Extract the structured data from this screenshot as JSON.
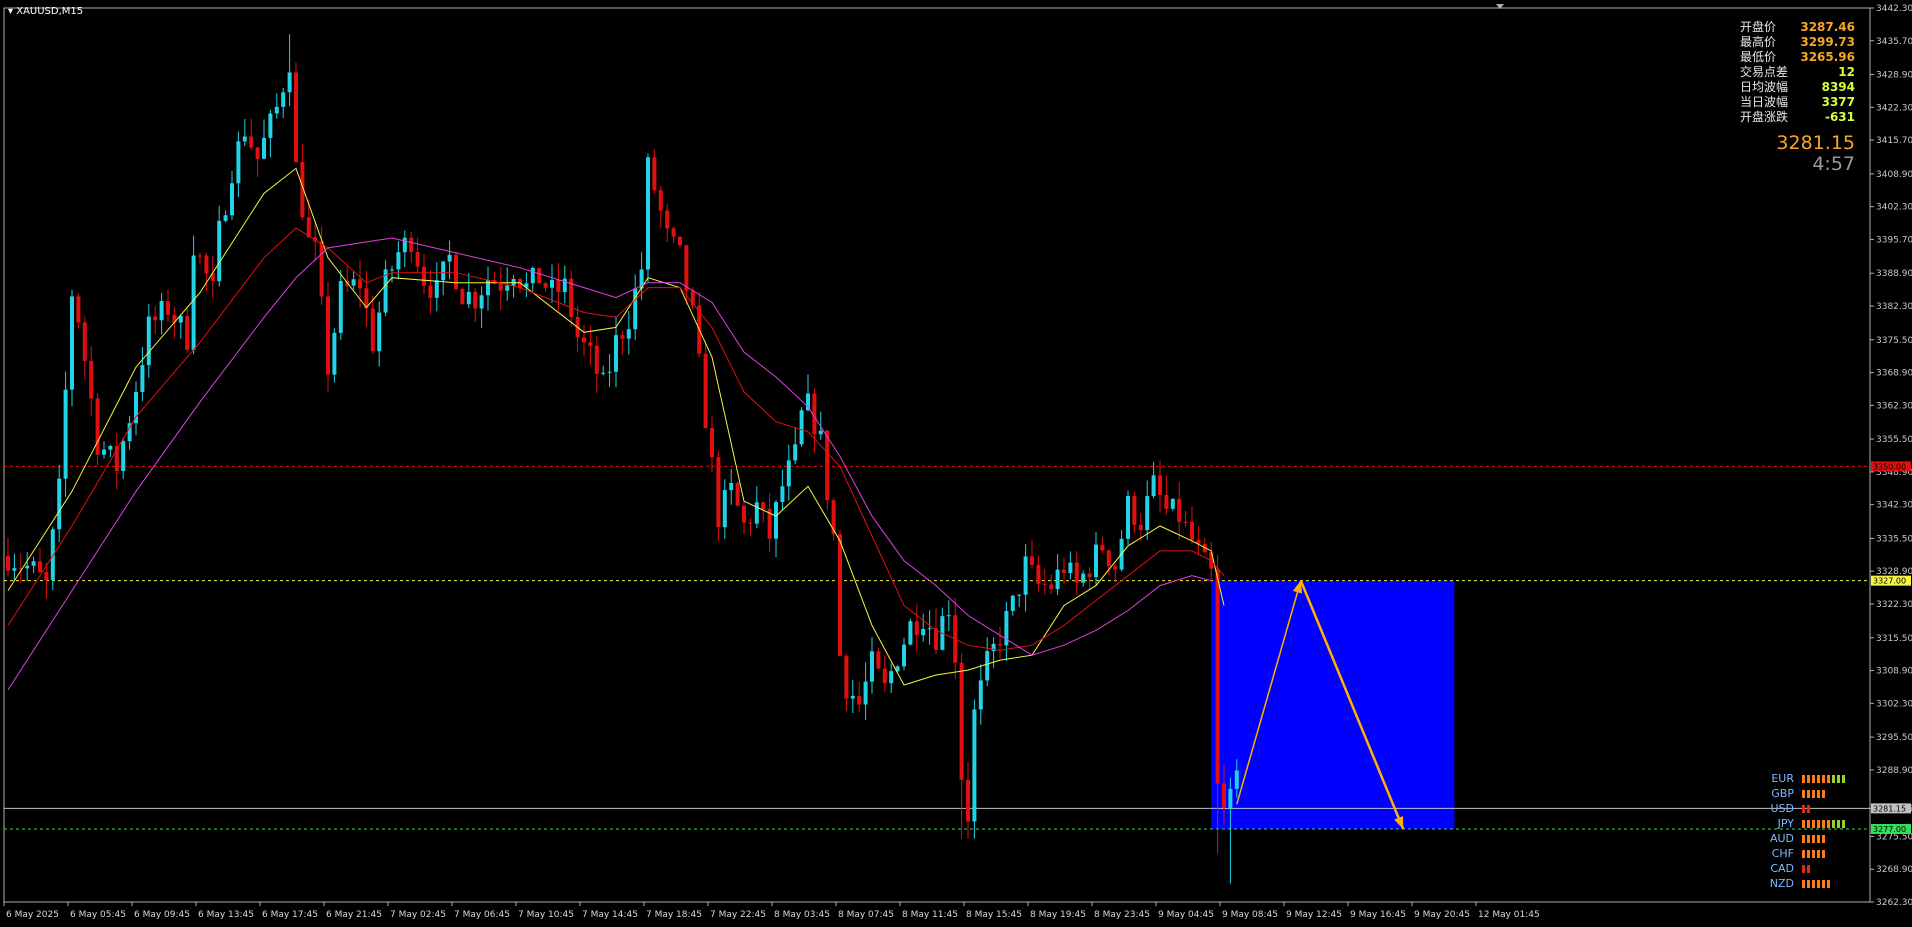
{
  "symbol": "XAUUSD,M15",
  "stats": [
    {
      "label": "开盘价",
      "value": "3287.46",
      "color": "#f5a623"
    },
    {
      "label": "最高价",
      "value": "3299.73",
      "color": "#f5a623"
    },
    {
      "label": "最低价",
      "value": "3265.96",
      "color": "#f5a623"
    },
    {
      "label": "交易点差",
      "value": "12",
      "color": "#d4ff3a"
    },
    {
      "label": "日均波幅",
      "value": "8394",
      "color": "#d4ff3a"
    },
    {
      "label": "当日波幅",
      "value": "3377",
      "color": "#d4ff3a"
    },
    {
      "label": "开盘涨跌",
      "value": "-631",
      "color": "#d4ff3a"
    }
  ],
  "current_price": "3281.15",
  "timer": "4:57",
  "currencies": [
    {
      "name": "EUR",
      "strength": 9,
      "colors": "orange-green"
    },
    {
      "name": "GBP",
      "strength": 5,
      "colors": "orange"
    },
    {
      "name": "USD",
      "strength": 2,
      "colors": "red"
    },
    {
      "name": "JPY",
      "strength": 9,
      "colors": "orange-green"
    },
    {
      "name": "AUD",
      "strength": 5,
      "colors": "orange"
    },
    {
      "name": "CHF",
      "strength": 5,
      "colors": "orange"
    },
    {
      "name": "CAD",
      "strength": 2,
      "colors": "red"
    },
    {
      "name": "NZD",
      "strength": 6,
      "colors": "orange"
    }
  ],
  "colors": {
    "background": "#000000",
    "bull": "#22d3e6",
    "bear": "#e01010",
    "ma_fast": "#f5f542",
    "ma_mid": "#e01010",
    "ma_slow": "#e040e0",
    "zone": "#0000ff",
    "arrow": "#ffb000"
  },
  "chart_data": {
    "type": "candlestick",
    "ylim": [
      3262.3,
      3442.3
    ],
    "y_ticks": [
      "3442.30",
      "3435.70",
      "3428.90",
      "3422.30",
      "3415.70",
      "3408.90",
      "3402.30",
      "3395.70",
      "3388.90",
      "3382.30",
      "3375.50",
      "3368.90",
      "3362.30",
      "3355.50",
      "3348.90",
      "3342.30",
      "3335.50",
      "3328.90",
      "3322.30",
      "3315.50",
      "3308.90",
      "3302.30",
      "3295.50",
      "3288.90",
      "3281.15",
      "3275.50",
      "3268.90",
      "3262.30"
    ],
    "x_ticks": [
      "6 May 2025",
      "6 May 05:45",
      "6 May 09:45",
      "6 May 13:45",
      "6 May 17:45",
      "6 May 21:45",
      "7 May 02:45",
      "7 May 06:45",
      "7 May 10:45",
      "7 May 14:45",
      "7 May 18:45",
      "7 May 22:45",
      "8 May 03:45",
      "8 May 07:45",
      "8 May 11:45",
      "8 May 15:45",
      "8 May 19:45",
      "8 May 23:45",
      "9 May 04:45",
      "9 May 08:45",
      "9 May 12:45",
      "9 May 16:45",
      "9 May 20:45",
      "12 May 01:45"
    ],
    "horizontal_levels": [
      {
        "value": 3350.0,
        "label": "3350.00",
        "style": "dashed",
        "color": "#e01010"
      },
      {
        "value": 3327.0,
        "label": "3327.00",
        "style": "dashed",
        "color": "#f5f542"
      },
      {
        "value": 3281.15,
        "label": "3281.15",
        "style": "solid",
        "color": "#c0c0c0"
      },
      {
        "value": 3277.0,
        "label": "3277.00",
        "style": "dashed",
        "color": "#33dd55"
      }
    ],
    "close_path": [
      [
        0,
        3332
      ],
      [
        4,
        3329
      ],
      [
        6,
        3326
      ],
      [
        8,
        3345
      ],
      [
        10,
        3385
      ],
      [
        11,
        3380
      ],
      [
        14,
        3355
      ],
      [
        17,
        3350
      ],
      [
        19,
        3360
      ],
      [
        22,
        3378
      ],
      [
        25,
        3382
      ],
      [
        28,
        3376
      ],
      [
        29,
        3395
      ],
      [
        32,
        3385
      ],
      [
        33,
        3397
      ],
      [
        35,
        3410
      ],
      [
        37,
        3418
      ],
      [
        39,
        3412
      ],
      [
        42,
        3422
      ],
      [
        44,
        3432
      ],
      [
        45,
        3410
      ],
      [
        47,
        3395
      ],
      [
        48,
        3393
      ],
      [
        50,
        3370
      ],
      [
        52,
        3385
      ],
      [
        55,
        3387
      ],
      [
        57,
        3375
      ],
      [
        59,
        3387
      ],
      [
        61,
        3393
      ],
      [
        63,
        3396
      ],
      [
        65,
        3388
      ],
      [
        67,
        3385
      ],
      [
        69,
        3392
      ],
      [
        71,
        3385
      ],
      [
        73,
        3384
      ],
      [
        75,
        3388
      ],
      [
        77,
        3387
      ],
      [
        79,
        3390
      ],
      [
        81,
        3386
      ],
      [
        83,
        3388
      ],
      [
        85,
        3385
      ],
      [
        87,
        3386
      ],
      [
        89,
        3376
      ],
      [
        91,
        3372
      ],
      [
        93,
        3366
      ],
      [
        94,
        3370
      ],
      [
        95,
        3375
      ],
      [
        97,
        3380
      ],
      [
        99,
        3390
      ],
      [
        100,
        3410
      ],
      [
        101,
        3406
      ],
      [
        103,
        3396
      ],
      [
        105,
        3392
      ],
      [
        107,
        3380
      ],
      [
        109,
        3360
      ],
      [
        111,
        3340
      ],
      [
        113,
        3345
      ],
      [
        115,
        3338
      ],
      [
        117,
        3342
      ],
      [
        119,
        3336
      ],
      [
        121,
        3346
      ],
      [
        123,
        3352
      ],
      [
        124,
        3360
      ],
      [
        125,
        3362
      ],
      [
        126,
        3359
      ],
      [
        127,
        3355
      ],
      [
        128,
        3345
      ],
      [
        129,
        3336
      ],
      [
        130,
        3312
      ],
      [
        131,
        3306
      ],
      [
        133,
        3302
      ],
      [
        135,
        3310
      ],
      [
        137,
        3305
      ],
      [
        139,
        3312
      ],
      [
        141,
        3318
      ],
      [
        143,
        3320
      ],
      [
        145,
        3316
      ],
      [
        147,
        3322
      ],
      [
        148,
        3312
      ],
      [
        149,
        3288
      ],
      [
        150,
        3280
      ],
      [
        151,
        3300
      ],
      [
        153,
        3310
      ],
      [
        155,
        3316
      ],
      [
        157,
        3322
      ],
      [
        159,
        3330
      ],
      [
        161,
        3326
      ],
      [
        163,
        3326
      ],
      [
        165,
        3330
      ],
      [
        167,
        3326
      ],
      [
        169,
        3330
      ],
      [
        171,
        3334
      ],
      [
        173,
        3330
      ],
      [
        175,
        3342
      ],
      [
        177,
        3339
      ],
      [
        179,
        3346
      ],
      [
        181,
        3341
      ],
      [
        183,
        3340
      ],
      [
        185,
        3335
      ],
      [
        187,
        3330
      ],
      [
        188,
        3328
      ],
      [
        189,
        3285
      ],
      [
        190,
        3280
      ],
      [
        191,
        3284
      ],
      [
        192,
        3288
      ]
    ],
    "moving_averages": [
      {
        "color": "#f5f542",
        "points": [
          [
            0,
            3325
          ],
          [
            10,
            3345
          ],
          [
            20,
            3370
          ],
          [
            30,
            3385
          ],
          [
            40,
            3405
          ],
          [
            45,
            3410
          ],
          [
            50,
            3392
          ],
          [
            56,
            3382
          ],
          [
            60,
            3388
          ],
          [
            70,
            3387
          ],
          [
            80,
            3387
          ],
          [
            90,
            3377
          ],
          [
            95,
            3378
          ],
          [
            100,
            3388
          ],
          [
            105,
            3386
          ],
          [
            110,
            3372
          ],
          [
            115,
            3343
          ],
          [
            120,
            3340
          ],
          [
            125,
            3346
          ],
          [
            130,
            3335
          ],
          [
            135,
            3318
          ],
          [
            140,
            3306
          ],
          [
            145,
            3308
          ],
          [
            150,
            3309
          ],
          [
            155,
            3311
          ],
          [
            160,
            3312
          ],
          [
            165,
            3322
          ],
          [
            170,
            3326
          ],
          [
            175,
            3334
          ],
          [
            180,
            3338
          ],
          [
            185,
            3335
          ],
          [
            188,
            3333
          ],
          [
            190,
            3322
          ]
        ]
      },
      {
        "color": "#e01010",
        "points": [
          [
            0,
            3318
          ],
          [
            10,
            3338
          ],
          [
            20,
            3360
          ],
          [
            30,
            3375
          ],
          [
            40,
            3392
          ],
          [
            45,
            3398
          ],
          [
            50,
            3394
          ],
          [
            56,
            3387
          ],
          [
            60,
            3389
          ],
          [
            70,
            3389
          ],
          [
            80,
            3386
          ],
          [
            90,
            3381
          ],
          [
            95,
            3380
          ],
          [
            100,
            3386
          ],
          [
            105,
            3386
          ],
          [
            110,
            3378
          ],
          [
            115,
            3365
          ],
          [
            120,
            3359
          ],
          [
            125,
            3357
          ],
          [
            130,
            3350
          ],
          [
            135,
            3336
          ],
          [
            140,
            3322
          ],
          [
            145,
            3317
          ],
          [
            150,
            3314
          ],
          [
            155,
            3313
          ],
          [
            160,
            3314
          ],
          [
            165,
            3318
          ],
          [
            170,
            3323
          ],
          [
            175,
            3328
          ],
          [
            180,
            3333
          ],
          [
            185,
            3333
          ],
          [
            188,
            3331
          ],
          [
            190,
            3328
          ]
        ]
      },
      {
        "color": "#e040e0",
        "points": [
          [
            0,
            3305
          ],
          [
            10,
            3325
          ],
          [
            20,
            3345
          ],
          [
            30,
            3363
          ],
          [
            40,
            3380
          ],
          [
            45,
            3388
          ],
          [
            50,
            3394
          ],
          [
            60,
            3396
          ],
          [
            70,
            3393
          ],
          [
            80,
            3390
          ],
          [
            90,
            3386
          ],
          [
            95,
            3384
          ],
          [
            100,
            3387
          ],
          [
            105,
            3387
          ],
          [
            110,
            3383
          ],
          [
            115,
            3373
          ],
          [
            120,
            3368
          ],
          [
            125,
            3362
          ],
          [
            130,
            3352
          ],
          [
            135,
            3340
          ],
          [
            140,
            3331
          ],
          [
            145,
            3326
          ],
          [
            150,
            3320
          ],
          [
            155,
            3316
          ],
          [
            160,
            3312
          ],
          [
            165,
            3314
          ],
          [
            170,
            3317
          ],
          [
            175,
            3321
          ],
          [
            180,
            3326
          ],
          [
            185,
            3328
          ],
          [
            188,
            3327
          ]
        ]
      }
    ],
    "zone": {
      "x_from": 188,
      "x_to": 226,
      "y_from": 3277.0,
      "y_to": 3327.0
    },
    "projection": [
      [
        192,
        3282
      ],
      [
        202,
        3327
      ],
      [
        218,
        3277
      ]
    ]
  }
}
